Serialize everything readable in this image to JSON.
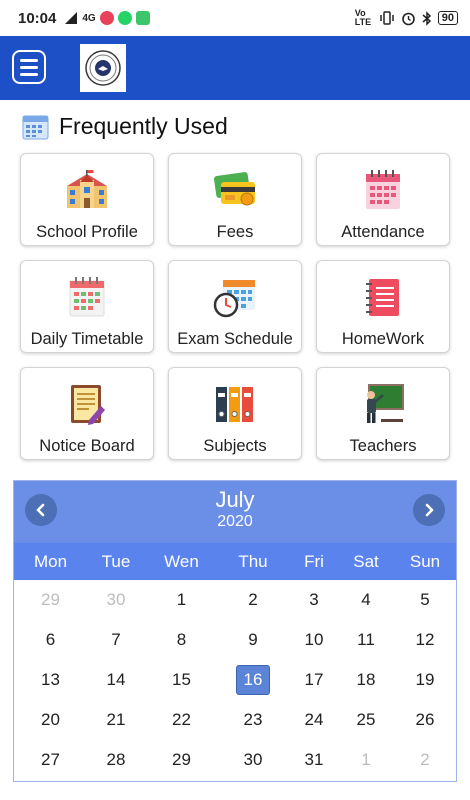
{
  "status_bar": {
    "time": "10:04",
    "network": "4G",
    "volte": "Vo LTE",
    "battery": "90"
  },
  "app_bar": {
    "menu_icon": "hamburger-menu-icon",
    "logo_icon": "school-logo-icon"
  },
  "section": {
    "title": "Frequently Used",
    "icon": "calendar-icon"
  },
  "tiles": [
    {
      "label": "School Profile",
      "icon": "school-building-icon"
    },
    {
      "label": "Fees",
      "icon": "credit-cards-icon"
    },
    {
      "label": "Attendance",
      "icon": "attendance-calendar-icon"
    },
    {
      "label": "Daily Timetable",
      "icon": "timetable-icon"
    },
    {
      "label": "Exam Schedule",
      "icon": "exam-schedule-icon"
    },
    {
      "label": "HomeWork",
      "icon": "notebook-icon"
    },
    {
      "label": "Notice Board",
      "icon": "notice-board-icon"
    },
    {
      "label": "Subjects",
      "icon": "binders-icon"
    },
    {
      "label": "Teachers",
      "icon": "teacher-blackboard-icon"
    }
  ],
  "calendar": {
    "month": "July",
    "year": "2020",
    "weekdays": [
      "Mon",
      "Tue",
      "Wen",
      "Thu",
      "Fri",
      "Sat",
      "Sun"
    ],
    "selected_day": "16",
    "days": [
      {
        "d": "29",
        "muted": true
      },
      {
        "d": "30",
        "muted": true
      },
      {
        "d": "1"
      },
      {
        "d": "2"
      },
      {
        "d": "3"
      },
      {
        "d": "4"
      },
      {
        "d": "5"
      },
      {
        "d": "6"
      },
      {
        "d": "7"
      },
      {
        "d": "8"
      },
      {
        "d": "9"
      },
      {
        "d": "10"
      },
      {
        "d": "11"
      },
      {
        "d": "12"
      },
      {
        "d": "13"
      },
      {
        "d": "14"
      },
      {
        "d": "15"
      },
      {
        "d": "16",
        "selected": true
      },
      {
        "d": "17"
      },
      {
        "d": "18"
      },
      {
        "d": "19"
      },
      {
        "d": "20"
      },
      {
        "d": "21"
      },
      {
        "d": "22"
      },
      {
        "d": "23"
      },
      {
        "d": "24"
      },
      {
        "d": "25"
      },
      {
        "d": "26"
      },
      {
        "d": "27"
      },
      {
        "d": "28"
      },
      {
        "d": "29"
      },
      {
        "d": "30"
      },
      {
        "d": "31"
      },
      {
        "d": "1",
        "muted": true
      },
      {
        "d": "2",
        "muted": true
      }
    ]
  },
  "colors": {
    "app_bar": "#1d4fc6",
    "calendar_header": "#6b8ee6",
    "weekday_bar": "#5b83ee",
    "selected_day": "#5b83d6"
  }
}
